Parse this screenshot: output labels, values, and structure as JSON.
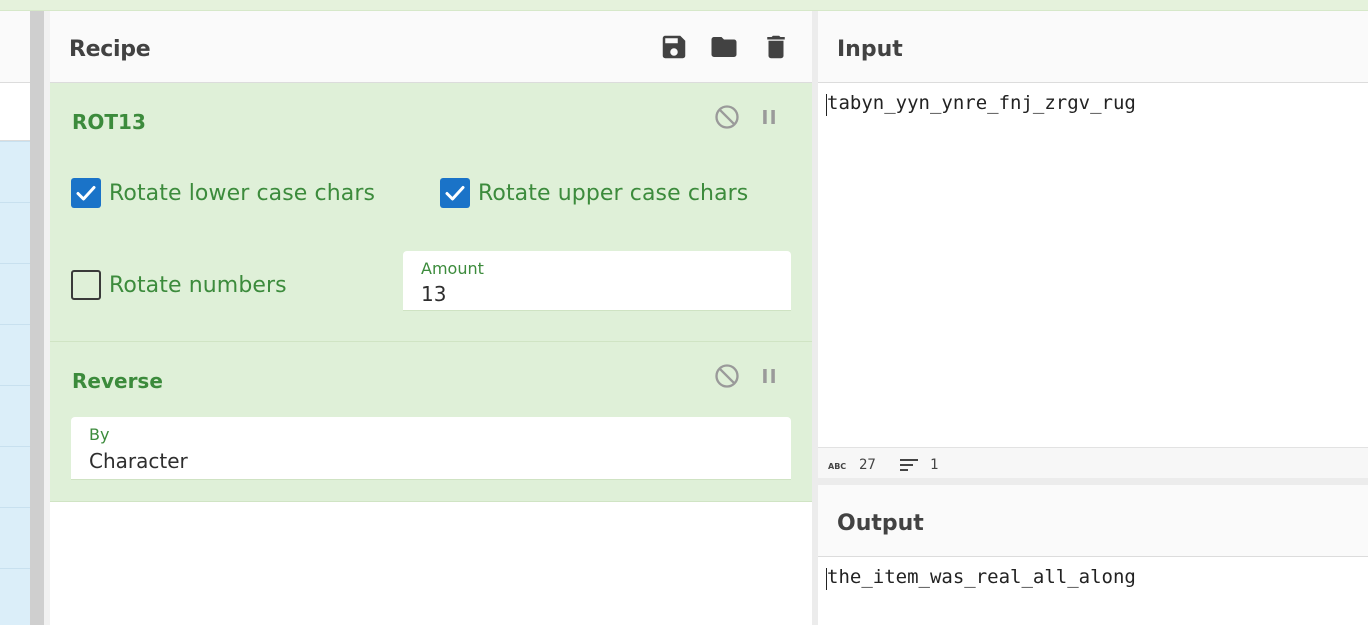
{
  "recipe": {
    "title": "Recipe",
    "icons": [
      "save-icon",
      "folder-open-icon",
      "trash-icon"
    ],
    "operations": [
      {
        "name": "ROT13",
        "controls": [
          "disable-icon",
          "pause-icon"
        ],
        "options": {
          "rotate_lower": {
            "label": "Rotate lower case chars",
            "checked": true
          },
          "rotate_upper": {
            "label": "Rotate upper case chars",
            "checked": true
          },
          "rotate_numbers": {
            "label": "Rotate numbers",
            "checked": false
          },
          "amount": {
            "label": "Amount",
            "value": "13"
          }
        }
      },
      {
        "name": "Reverse",
        "controls": [
          "disable-icon",
          "pause-icon"
        ],
        "options": {
          "by": {
            "label": "By",
            "value": "Character"
          }
        }
      }
    ]
  },
  "input": {
    "title": "Input",
    "text": "tabyn_yyn_ynre_fnj_zrgv_rug",
    "status": {
      "length_icon": "abc-icon",
      "length": "27",
      "lines_icon": "lines-icon",
      "lines": "1"
    }
  },
  "output": {
    "title": "Output",
    "text": "the_item_was_real_all_along"
  },
  "colors": {
    "operation_bg": "#dff0d8",
    "operation_text": "#3c8b3c",
    "checkbox": "#1a73c8",
    "operations_list_bg": "#dbeef9"
  }
}
